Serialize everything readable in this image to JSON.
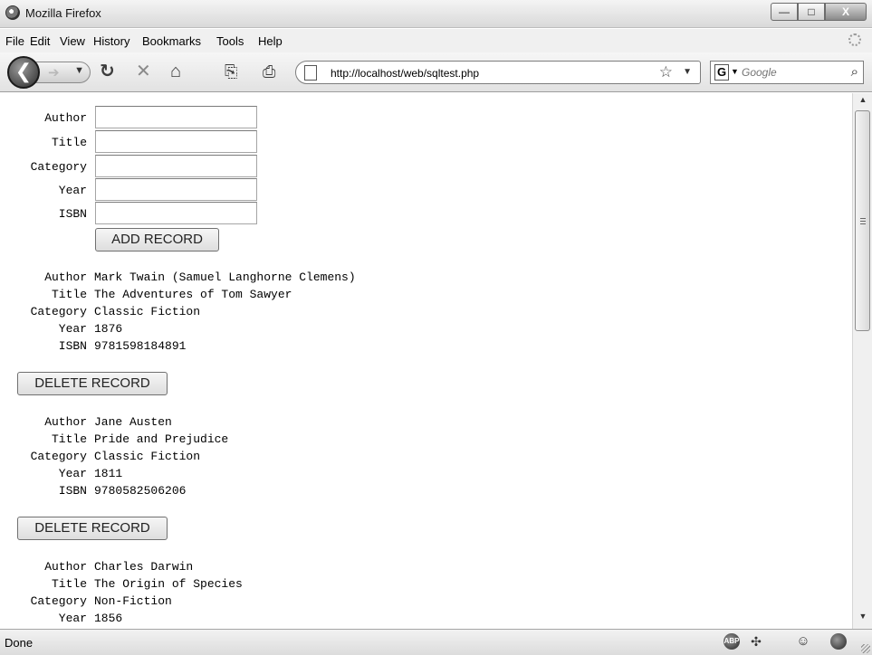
{
  "window": {
    "title": "Mozilla Firefox",
    "minimize": "—",
    "maximize": "□",
    "close": "X"
  },
  "menu": [
    "File",
    "Edit",
    "View",
    "History",
    "Bookmarks",
    "Tools",
    "Help"
  ],
  "nav": {
    "url": "http://localhost/web/sqltest.php",
    "search_placeholder": "Google",
    "search_engine": "G"
  },
  "form": {
    "fields": [
      {
        "label": "Author",
        "value": ""
      },
      {
        "label": "Title",
        "value": ""
      },
      {
        "label": "Category",
        "value": ""
      },
      {
        "label": "Year",
        "value": ""
      },
      {
        "label": "ISBN",
        "value": ""
      }
    ],
    "submit_label": "ADD RECORD"
  },
  "records": [
    {
      "author": "Mark Twain (Samuel Langhorne Clemens)",
      "title": "The Adventures of Tom Sawyer",
      "category": "Classic Fiction",
      "year": "1876",
      "isbn": "9781598184891"
    },
    {
      "author": "Jane Austen",
      "title": "Pride and Prejudice",
      "category": "Classic Fiction",
      "year": "1811",
      "isbn": "9780582506206"
    },
    {
      "author": "Charles Darwin",
      "title": "The Origin of Species",
      "category": "Non-Fiction",
      "year": "1856",
      "isbn": ""
    }
  ],
  "record_labels": {
    "author": "Author",
    "title": "Title",
    "category": "Category",
    "year": "Year",
    "isbn": "ISBN"
  },
  "delete_label": "DELETE RECORD",
  "status": {
    "text": "Done",
    "icons": [
      "adblock-icon",
      "greasemonkey-icon",
      "smiley-icon",
      "firefox-icon"
    ]
  }
}
